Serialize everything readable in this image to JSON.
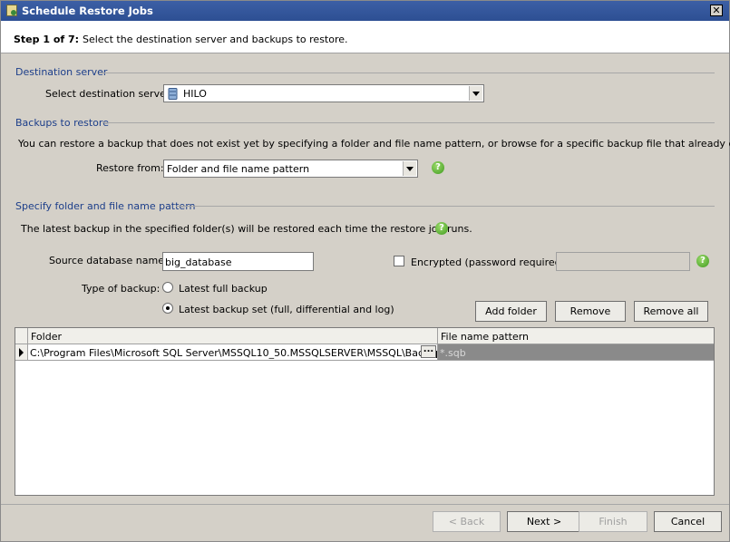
{
  "window": {
    "title": "Schedule Restore Jobs",
    "close_glyph": "✕"
  },
  "step": {
    "number": "Step 1 of 7:",
    "description": "Select the destination server and backups to restore."
  },
  "destination": {
    "group_label": "Destination server",
    "server_label": "Select destination server:",
    "server_value": "HILO"
  },
  "backups": {
    "group_label": "Backups to restore",
    "description": "You can restore a backup that does not exist yet by specifying a folder and file name pattern, or browse for a specific backup file that already exists.",
    "restore_from_label": "Restore from:",
    "restore_from_value": "Folder and file name pattern"
  },
  "pattern": {
    "group_label": "Specify folder and file name pattern",
    "description": "The latest backup in the specified folder(s) will be restored each time the restore job runs.",
    "source_db_label": "Source database name:",
    "source_db_value": "big_database",
    "encrypted_label": "Encrypted (password required):",
    "encrypted_checked": false,
    "type_label": "Type of backup:",
    "radio_full": "Latest full backup",
    "radio_set": "Latest backup set (full, differential and log)",
    "selected_type": "set",
    "add_folder": "Add folder",
    "remove": "Remove",
    "remove_all": "Remove all"
  },
  "grid": {
    "columns": [
      "Folder",
      "File name pattern"
    ],
    "rows": [
      {
        "folder": "C:\\Program Files\\Microsoft SQL Server\\MSSQL10_50.MSSQLSERVER\\MSSQL\\Backup",
        "pattern": "*.sqb"
      }
    ],
    "browse_glyph": "..."
  },
  "footer": {
    "back": "< Back",
    "next": "Next >",
    "finish": "Finish",
    "cancel": "Cancel"
  },
  "icons": {
    "help": "help-icon",
    "server": "server-icon",
    "app": "app-icon"
  },
  "colors": {
    "titlebar": "#2d4f93",
    "group_label": "#1c3e8a",
    "help": "#3f9a1f"
  }
}
